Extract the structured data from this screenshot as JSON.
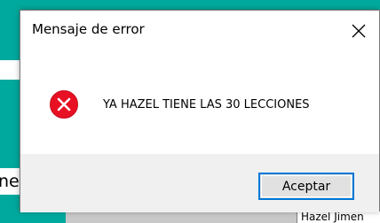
{
  "dialog": {
    "title": "Mensaje de error",
    "message": "YA HAZEL TIENE LAS 30 LECCIONES",
    "ok_label": "Aceptar",
    "icon": "error-icon"
  },
  "background": {
    "left_fragment": "ne",
    "cell_text": "Hazel Jimen"
  },
  "colors": {
    "desktop": "#00a99d",
    "error_red": "#e81123",
    "button_border": "#0078d7"
  }
}
